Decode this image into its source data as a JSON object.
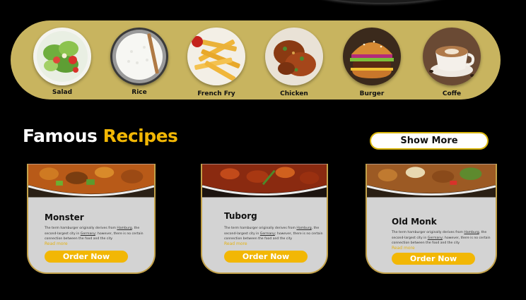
{
  "categories": [
    {
      "label": "Salad",
      "icon": "salad-icon"
    },
    {
      "label": "Rice",
      "icon": "rice-icon"
    },
    {
      "label": "French Fry",
      "icon": "french-fry-icon"
    },
    {
      "label": "Chicken",
      "icon": "chicken-icon"
    },
    {
      "label": "Burger",
      "icon": "burger-icon"
    },
    {
      "label": "Coffe",
      "icon": "coffee-icon"
    }
  ],
  "section": {
    "title_white": "Famous",
    "title_yellow": "Recipes",
    "show_more": "Show More"
  },
  "cards": [
    {
      "name": "Monster",
      "desc_1": "The term hamburger originally derives from ",
      "desc_link1": "Hamburg",
      "desc_2": ", the second-largest city in ",
      "desc_link2": "Germany",
      "desc_3": "; however, there is no certain connection between the food and the city",
      "read_more": "Read more",
      "order": "Order Now"
    },
    {
      "name": "Tuborg",
      "desc_1": "The term hamburger originally derives from ",
      "desc_link1": "Hamburg",
      "desc_2": ", the second-largest city in ",
      "desc_link2": "Germany",
      "desc_3": "; however, there is no certain connection between the food and the city",
      "read_more": "Read more",
      "order": "Order Now"
    },
    {
      "name": "Old Monk",
      "desc_1": "The term hamburger originally derives from ",
      "desc_link1": "Hamburg",
      "desc_2": ", the second-largest city in ",
      "desc_link2": "Germany",
      "desc_3": "; however, there is no certain connection between the food and the city",
      "read_more": "Read more",
      "order": "Order Now"
    }
  ],
  "colors": {
    "background": "#000000",
    "category_bar": "#c8b45f",
    "accent_yellow": "#f2b705",
    "card_bg": "#d3d3d3"
  }
}
